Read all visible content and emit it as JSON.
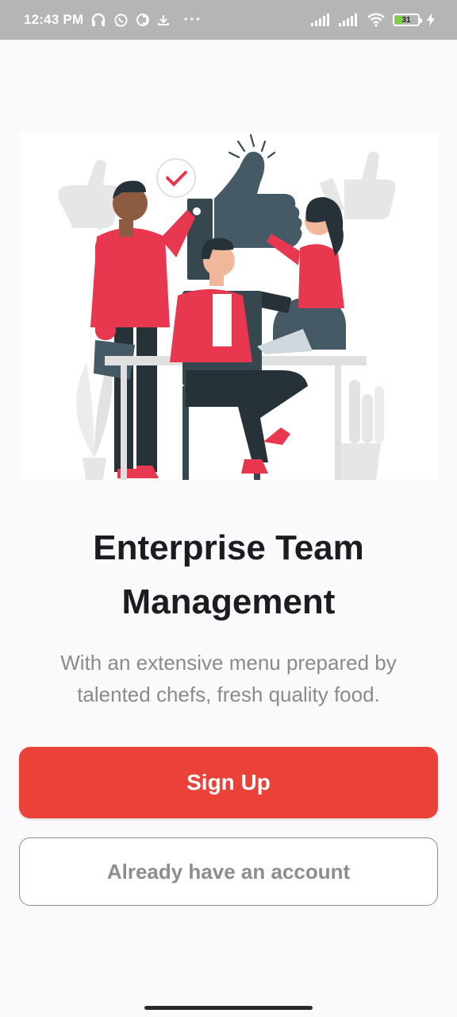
{
  "status_bar": {
    "time": "12:43 PM",
    "battery_level": "31",
    "left_icons": [
      "headphones-icon",
      "whatsapp-icon",
      "vpn-icon",
      "download-icon"
    ],
    "more": "···",
    "right_icons": [
      "signal-icon",
      "signal-icon",
      "wifi-icon",
      "battery-icon",
      "charging-icon"
    ]
  },
  "onboarding": {
    "illustration": "team-thumbs-up-illustration",
    "title": "Enterprise Team Management",
    "subtitle": "With an extensive menu prepared by talented chefs, fresh quality food.",
    "primary_button": "Sign Up",
    "secondary_button": "Already have an account"
  },
  "colors": {
    "accent": "#EA4238",
    "illustration_red": "#E8384F",
    "illustration_dark": "#37474F",
    "status_bar": "#B5B4B6",
    "background": "#FCF9FC"
  }
}
